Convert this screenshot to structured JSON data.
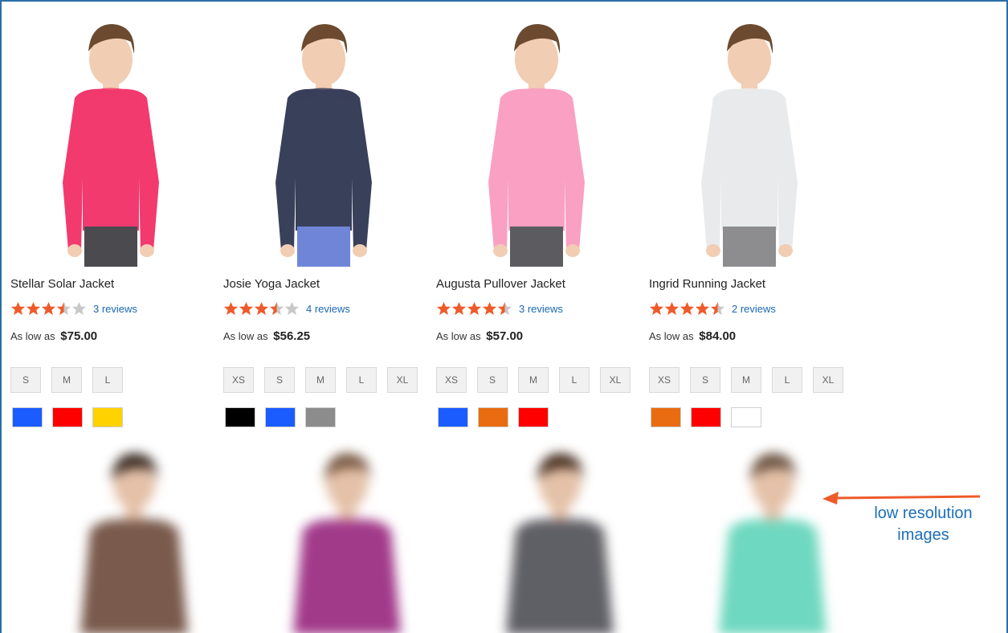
{
  "products": [
    {
      "name": "Stellar Solar Jacket",
      "rating": 3.5,
      "reviews_label": "3 reviews",
      "price_prefix": "As low as",
      "price": "$75.00",
      "sizes": [
        "S",
        "M",
        "L"
      ],
      "colors": [
        "#1a5cff",
        "#ff0000",
        "#ffd200"
      ],
      "jacket_color": "#f23a6e",
      "pants_color": "#4a4a4f"
    },
    {
      "name": "Josie Yoga Jacket",
      "rating": 3.5,
      "reviews_label": "4 reviews",
      "price_prefix": "As low as",
      "price": "$56.25",
      "sizes": [
        "XS",
        "S",
        "M",
        "L",
        "XL"
      ],
      "colors": [
        "#000000",
        "#1a5cff",
        "#8c8c8c"
      ],
      "jacket_color": "#39405a",
      "pants_color": "#6f86d8"
    },
    {
      "name": "Augusta Pullover Jacket",
      "rating": 4.5,
      "reviews_label": "3 reviews",
      "price_prefix": "As low as",
      "price": "$57.00",
      "sizes": [
        "XS",
        "S",
        "M",
        "L",
        "XL"
      ],
      "colors": [
        "#1a5cff",
        "#ea6c10",
        "#ff0000"
      ],
      "jacket_color": "#f9a0c3",
      "pants_color": "#5c5c60"
    },
    {
      "name": "Ingrid Running Jacket",
      "rating": 4.5,
      "reviews_label": "2 reviews",
      "price_prefix": "As low as",
      "price": "$84.00",
      "sizes": [
        "XS",
        "S",
        "M",
        "L",
        "XL"
      ],
      "colors": [
        "#ea6c10",
        "#ff0000",
        "#ffffff"
      ],
      "jacket_color": "#e9eaeb",
      "pants_color": "#8d8d90"
    }
  ],
  "blurred_products": [
    {
      "jacket_color": "#7a5a4c",
      "hair_color": "#3a2a22"
    },
    {
      "jacket_color": "#a23a8a",
      "hair_color": "#7a5a44"
    },
    {
      "jacket_color": "#5f5f66",
      "hair_color": "#4a3122"
    },
    {
      "jacket_color": "#6fd8c0",
      "hair_color": "#6a5240"
    }
  ],
  "annotation": {
    "text_line1": "low resolution",
    "text_line2": "images",
    "color": "#1d6fb8",
    "arrow_color": "#ef5a2a"
  },
  "theme": {
    "star_filled": "#ef5a2a",
    "star_empty": "#c8c8c8",
    "link": "#1a67b5",
    "frame": "#2a6fa8"
  }
}
